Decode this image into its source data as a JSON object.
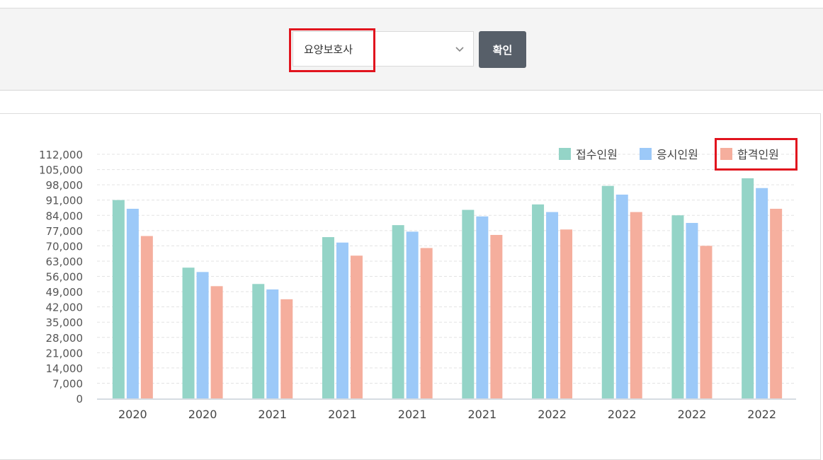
{
  "filter": {
    "selected_value": "요양보호사",
    "confirm_label": "확인"
  },
  "colors": {
    "applicants": "#94d4c7",
    "examinees": "#9cc9f8",
    "passers": "#f5ae9d",
    "highlight": "#e1141e",
    "button": "#575f69"
  },
  "chart_data": {
    "type": "bar",
    "categories": [
      "2020",
      "2020",
      "2021",
      "2021",
      "2021",
      "2021",
      "2022",
      "2022",
      "2022",
      "2022"
    ],
    "series": [
      {
        "name": "접수인원",
        "values": [
          91000,
          60000,
          52500,
          74000,
          79500,
          86500,
          89000,
          97500,
          84000,
          101000
        ]
      },
      {
        "name": "응시인원",
        "values": [
          87000,
          58000,
          50000,
          71500,
          76500,
          83500,
          85500,
          93500,
          80500,
          96500
        ]
      },
      {
        "name": "합격인원",
        "values": [
          74500,
          51500,
          45500,
          65500,
          69000,
          75000,
          77500,
          85500,
          70000,
          87000
        ]
      }
    ],
    "yticks": [
      0,
      7000,
      14000,
      21000,
      28000,
      35000,
      42000,
      49000,
      56000,
      63000,
      70000,
      77000,
      84000,
      91000,
      98000,
      105000,
      112000
    ],
    "ylim": [
      0,
      112000
    ],
    "grid": true,
    "legend_position": "top-right"
  }
}
